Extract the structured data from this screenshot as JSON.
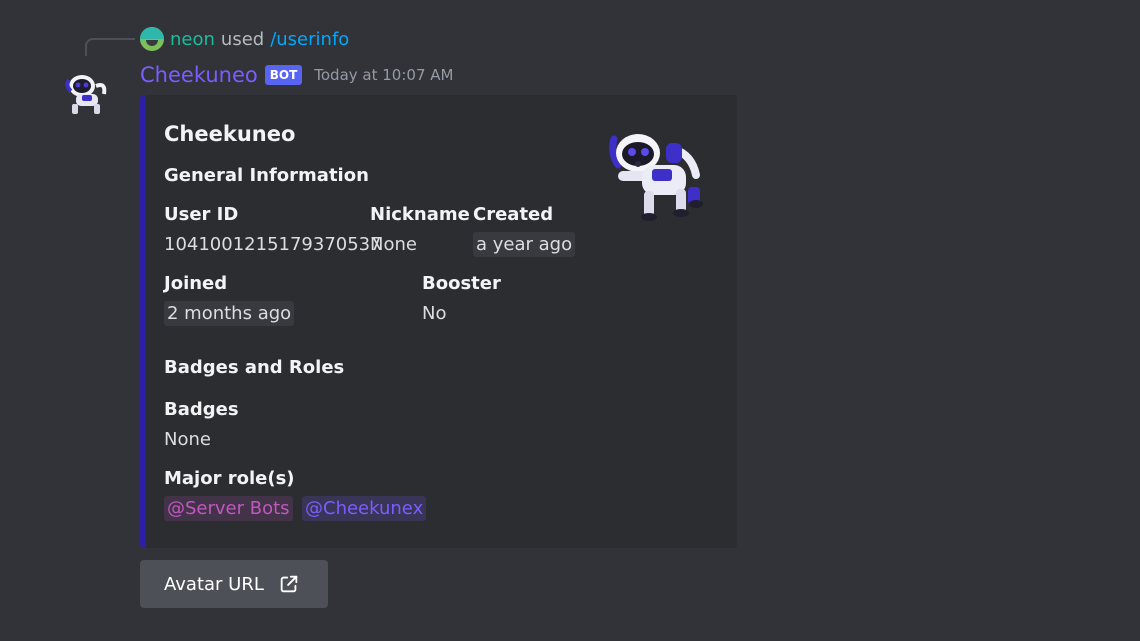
{
  "reply": {
    "username": "neon",
    "used_text": "used",
    "command": "/userinfo"
  },
  "message": {
    "author": "Cheekuneo",
    "bot_tag": "BOT",
    "timestamp": "Today at 10:07 AM"
  },
  "embed": {
    "accent_color": "#2d1ea6",
    "title": "Cheekuneo",
    "general_section": "General Information",
    "fields": [
      {
        "name": "User ID",
        "value": "1041001215179370537"
      },
      {
        "name": "Nickname",
        "value": "None"
      },
      {
        "name": "Created",
        "value": "a year ago"
      },
      {
        "name": "Joined",
        "value": "2 months ago"
      },
      {
        "name": "Booster",
        "value": "No"
      }
    ],
    "badges_section": "Badges and Roles",
    "badges_field": {
      "name": "Badges",
      "value": "None"
    },
    "roles_field": {
      "name": "Major role(s)"
    },
    "roles": [
      {
        "label": "@Server Bots",
        "color": "#c157c1"
      },
      {
        "label": "@Cheekunex",
        "color": "#7c5cff"
      }
    ]
  },
  "button": {
    "label": "Avatar URL",
    "icon": "external-link-icon"
  }
}
